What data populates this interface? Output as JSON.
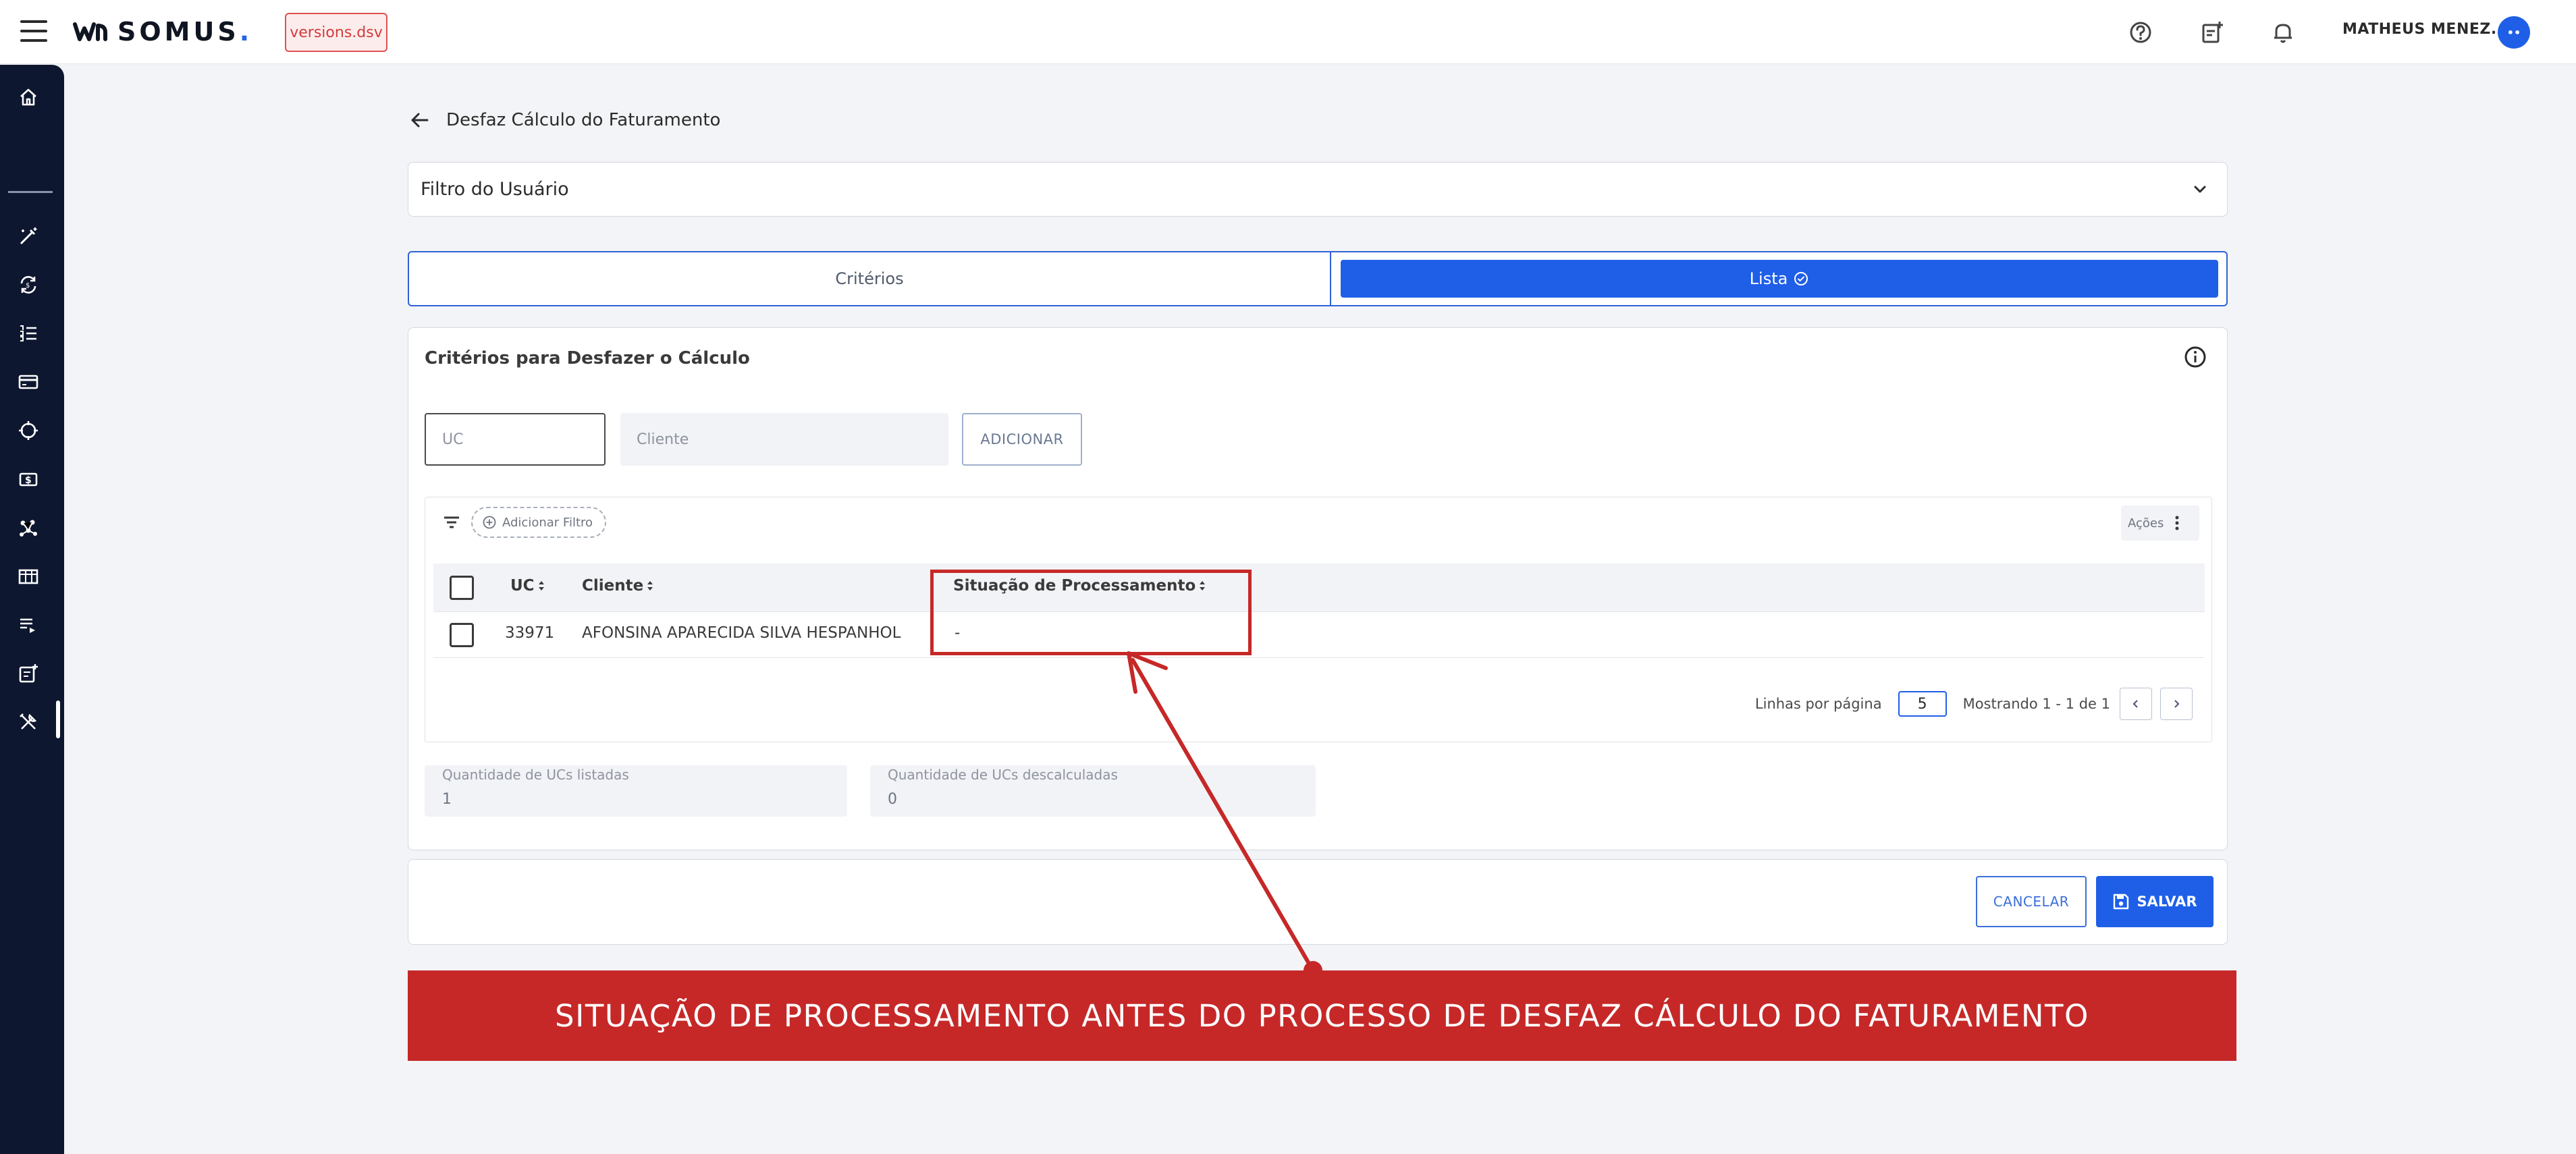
{
  "app": {
    "logo_text": "SOMUS",
    "env_badge": "versions.dsv",
    "user_name": "MATHEUS MENEZ...",
    "avatar_text": "••"
  },
  "page": {
    "title": "Desfaz Cálculo do Faturamento"
  },
  "filter_panel": {
    "label": "Filtro do Usuário"
  },
  "tabs": [
    {
      "label": "Critérios",
      "active": false
    },
    {
      "label": "Lista",
      "active": true
    }
  ],
  "criteria": {
    "title": "Critérios para Desfazer o Cálculo",
    "uc_placeholder": "UC",
    "cliente_placeholder": "Cliente",
    "add_button": "ADICIONAR"
  },
  "table": {
    "add_filter": "Adicionar Filtro",
    "actions": "Ações",
    "columns": [
      "UC",
      "Cliente",
      "Situação de Processamento"
    ],
    "rows": [
      {
        "uc": "33971",
        "cliente": "AFONSINA APARECIDA SILVA HESPANHOL",
        "situacao": "-"
      }
    ],
    "rows_per_page_label": "Linhas por página",
    "rows_per_page": "5",
    "showing": "Mostrando 1 - 1 de 1"
  },
  "stats": {
    "listed_label": "Quantidade de UCs listadas",
    "listed_value": "1",
    "undone_label": "Quantidade de UCs descalculadas",
    "undone_value": "0"
  },
  "footer": {
    "cancel": "CANCELAR",
    "save": "SALVAR"
  },
  "annotation": {
    "banner": "SITUAÇÃO DE PROCESSAMENTO ANTES DO PROCESSO DE DESFAZ CÁLCULO DO FATURAMENTO",
    "color": "#c62828"
  },
  "colors": {
    "primary": "#1f5fe8",
    "sidebar": "#0e1730",
    "badge": "#d23c3c"
  },
  "sidebar_icons": [
    "home-icon",
    "magic-wand-icon",
    "recycle-icon",
    "list-numbers-icon",
    "credit-card-icon",
    "crosshair-icon",
    "dollar-icon",
    "network-icon",
    "table-icon",
    "playlist-icon",
    "document-add-icon",
    "tools-icon"
  ]
}
